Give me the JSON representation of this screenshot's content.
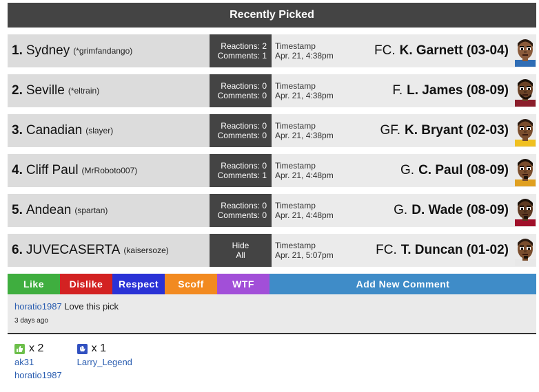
{
  "header": {
    "title": "Recently Picked"
  },
  "rows": [
    {
      "num": "1.",
      "name": "Sydney",
      "user": "(*grimfandango)",
      "react1": "Reactions: 2",
      "react2": "Comments: 1",
      "ts_label": "Timestamp",
      "ts_value": "Apr. 21, 4:38pm",
      "pos": "FC.",
      "player": "K. Garnett (03-04)",
      "skin": "#8a5a3a",
      "hair": "#2a1a10",
      "jersey": "#2f6db5",
      "beard": "none"
    },
    {
      "num": "2.",
      "name": "Seville",
      "user": "(*eltrain)",
      "react1": "Reactions: 0",
      "react2": "Comments: 0",
      "ts_label": "Timestamp",
      "ts_value": "Apr. 21, 4:38pm",
      "pos": "F.",
      "player": "L. James (08-09)",
      "skin": "#6b4226",
      "hair": "#1a1008",
      "jersey": "#8b1e2b",
      "beard": "full"
    },
    {
      "num": "3.",
      "name": "Canadian",
      "user": "(slayer)",
      "react1": "Reactions: 0",
      "react2": "Comments: 0",
      "ts_label": "Timestamp",
      "ts_value": "Apr. 21, 4:38pm",
      "pos": "GF.",
      "player": "K. Bryant (02-03)",
      "skin": "#7a4d2d",
      "hair": "#2a1a10",
      "jersey": "#f0c020",
      "beard": "none"
    },
    {
      "num": "4.",
      "name": "Cliff Paul",
      "user": "(MrRoboto007)",
      "react1": "Reactions: 0",
      "react2": "Comments: 1",
      "ts_label": "Timestamp",
      "ts_value": "Apr. 21, 4:48pm",
      "pos": "G.",
      "player": "C. Paul (08-09)",
      "skin": "#7a4d2d",
      "hair": "#1a1008",
      "jersey": "#e0a020",
      "beard": "goatee"
    },
    {
      "num": "5.",
      "name": "Andean",
      "user": "(spartan)",
      "react1": "Reactions: 0",
      "react2": "Comments: 0",
      "ts_label": "Timestamp",
      "ts_value": "Apr. 21, 4:48pm",
      "pos": "G.",
      "player": "D. Wade (08-09)",
      "skin": "#5e3a22",
      "hair": "#1a1008",
      "jersey": "#a0102a",
      "beard": "goatee"
    },
    {
      "num": "6.",
      "name": "JUVECASERTA",
      "user": "(kaisersoze)",
      "react1": "Hide",
      "react2": "All",
      "ts_label": "Timestamp",
      "ts_value": "Apr. 21, 5:07pm",
      "pos": "FC.",
      "player": "T. Duncan (01-02)",
      "skin": "#7a4d2d",
      "hair": "#2a1a10",
      "jersey": "#e8e8e8",
      "beard": "goatee"
    }
  ],
  "reaction_buttons": [
    {
      "label": "Like",
      "color": "#3fae3f"
    },
    {
      "label": "Dislike",
      "color": "#d32222"
    },
    {
      "label": "Respect",
      "color": "#2a32d6"
    },
    {
      "label": "Scoff",
      "color": "#f28a20"
    },
    {
      "label": "WTF",
      "color": "#a24fd8"
    },
    {
      "label": "Add New Comment",
      "color": "#3f8cc8"
    }
  ],
  "comment": {
    "author": "horatio1987",
    "text": "Love this pick",
    "ago": "3 days ago"
  },
  "reactions": [
    {
      "icon": "thumbs-up-icon",
      "color": "#6cbf4a",
      "count": "x 2",
      "users": [
        "ak31",
        "horatio1987"
      ]
    },
    {
      "icon": "hand-icon",
      "color": "#3050c0",
      "count": "x 1",
      "users": [
        "Larry_Legend"
      ]
    }
  ]
}
